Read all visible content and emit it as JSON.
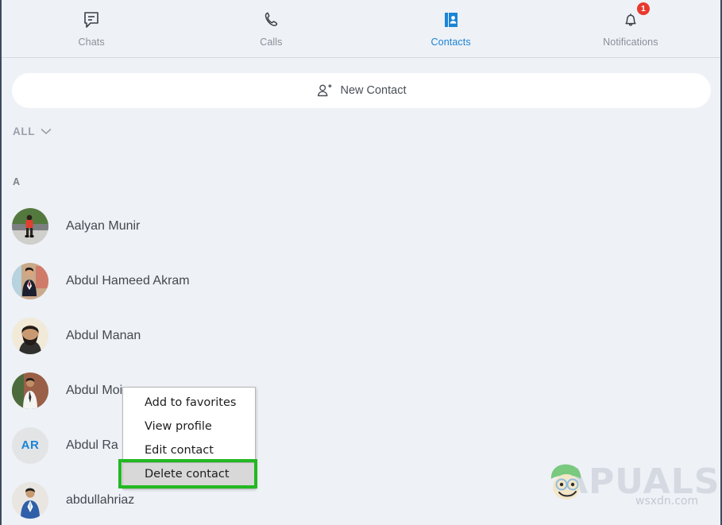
{
  "nav": {
    "items": [
      {
        "label": "Chats",
        "icon": "chat-bubble-icon",
        "active": false,
        "badge": null
      },
      {
        "label": "Calls",
        "icon": "phone-icon",
        "active": false,
        "badge": null
      },
      {
        "label": "Contacts",
        "icon": "address-book-icon",
        "active": true,
        "badge": null
      },
      {
        "label": "Notifications",
        "icon": "bell-icon",
        "active": false,
        "badge": "1"
      }
    ]
  },
  "new_contact": {
    "label": "New Contact",
    "icon": "person-add-icon"
  },
  "filter": {
    "label": "ALL",
    "icon": "chevron-down-icon"
  },
  "section_header": "A",
  "contacts": [
    {
      "name": "Aalyan Munir",
      "avatar_type": "photo",
      "initials": ""
    },
    {
      "name": "Abdul Hameed Akram",
      "avatar_type": "photo",
      "initials": ""
    },
    {
      "name": "Abdul Manan",
      "avatar_type": "photo",
      "initials": ""
    },
    {
      "name": "Abdul Moiz",
      "avatar_type": "photo",
      "initials": ""
    },
    {
      "name": "Abdul Ra",
      "avatar_type": "initials",
      "initials": "AR"
    },
    {
      "name": "abdullahriaz",
      "avatar_type": "photo",
      "initials": ""
    }
  ],
  "context_menu": {
    "items": [
      {
        "label": "Add to favorites",
        "highlighted": false
      },
      {
        "label": "View profile",
        "highlighted": false
      },
      {
        "label": "Edit contact",
        "highlighted": false
      },
      {
        "label": "Delete contact",
        "highlighted": true
      }
    ]
  },
  "watermark": {
    "text": "APUALS",
    "site": "wsxdn.com"
  },
  "colors": {
    "background": "#eef1f6",
    "accent": "#1a84d6",
    "badge": "#e8392e",
    "highlight_box": "#23b822",
    "muted_text": "#8b8f98"
  }
}
